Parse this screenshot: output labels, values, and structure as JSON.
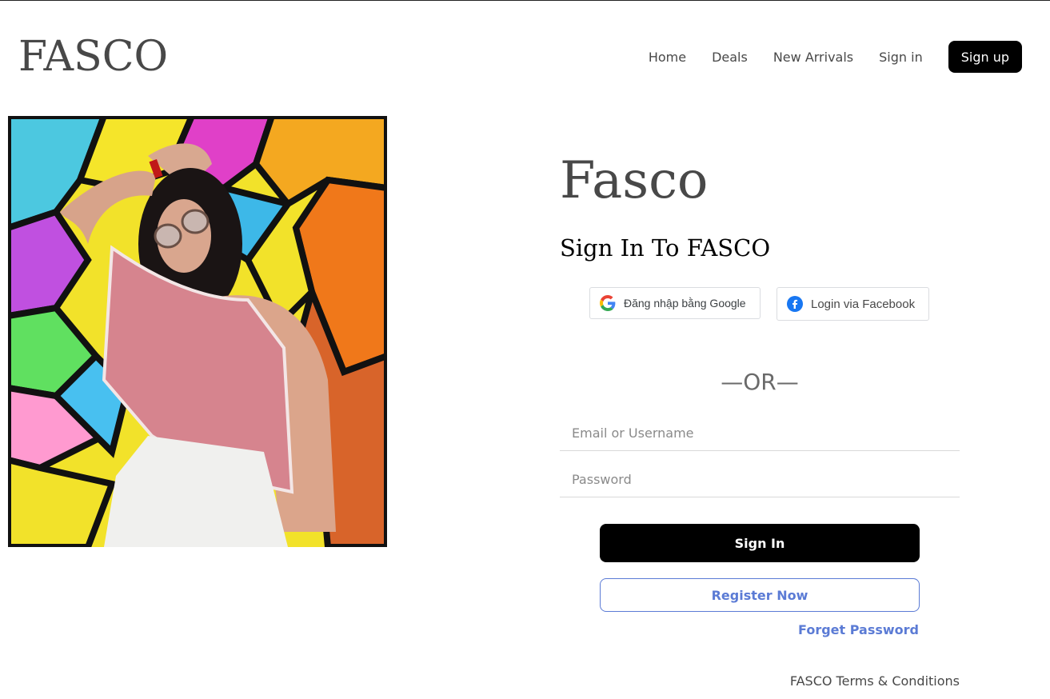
{
  "header": {
    "logo": "FASCO",
    "nav": [
      "Home",
      "Deals",
      "New Arrivals",
      "Sign in"
    ],
    "signup": "Sign up"
  },
  "main": {
    "brand": "Fasco",
    "title": "Sign In To FASCO",
    "google_label": "Đăng nhập bằng Google",
    "facebook_label": "Login via Facebook",
    "or": "—OR—",
    "email_placeholder": "Email or Username",
    "password_placeholder": "Password",
    "signin": "Sign In",
    "register": "Register Now",
    "forget": "Forget Password",
    "terms": "FASCO Terms & Conditions"
  }
}
